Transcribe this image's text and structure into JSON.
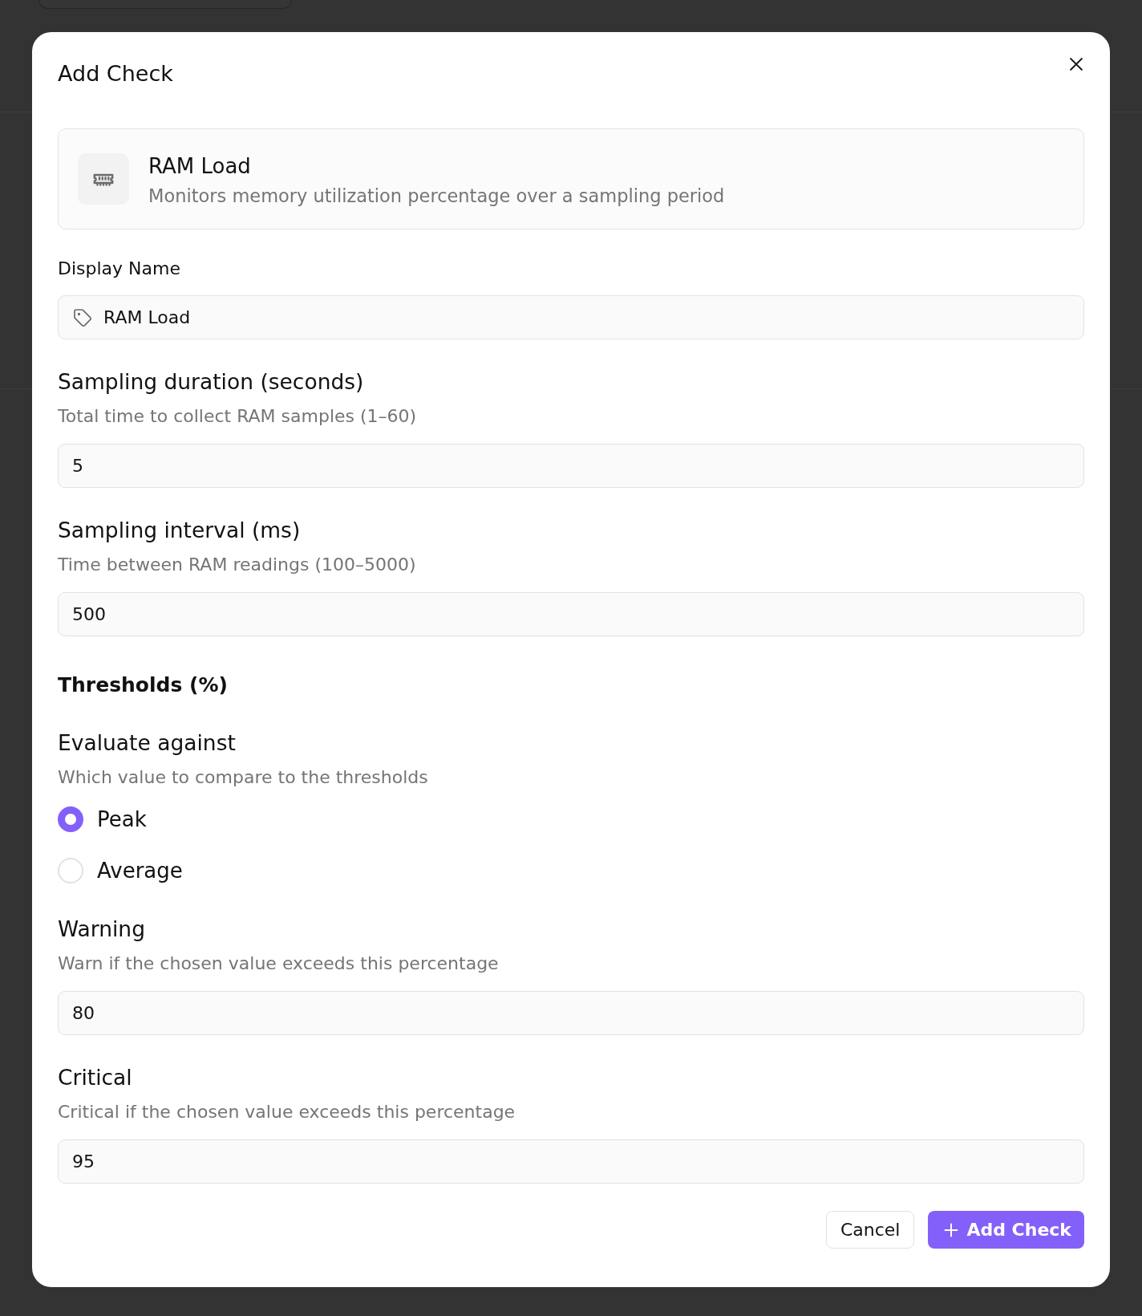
{
  "dialog": {
    "title": "Add Check"
  },
  "check_type": {
    "name": "RAM Load",
    "description": "Monitors memory utilization percentage over a sampling period"
  },
  "display_name": {
    "label": "Display Name",
    "value": "RAM Load"
  },
  "sampling": [
    {
      "label": "Sampling duration (seconds)",
      "hint": "Total time to collect RAM samples (1–60)",
      "value": "5"
    },
    {
      "label": "Sampling interval (ms)",
      "hint": "Time between RAM readings (100–5000)",
      "value": "500"
    }
  ],
  "thresholds": {
    "heading": "Thresholds (%)",
    "evaluate": {
      "label": "Evaluate against",
      "hint": "Which value to compare to the thresholds",
      "options": [
        {
          "label": "Peak",
          "selected": true
        },
        {
          "label": "Average",
          "selected": false
        }
      ]
    },
    "levels": [
      {
        "label": "Warning",
        "hint": "Warn if the chosen value exceeds this percentage",
        "value": "80"
      },
      {
        "label": "Critical",
        "hint": "Critical if the chosen value exceeds this percentage",
        "value": "95"
      }
    ]
  },
  "buttons": [
    {
      "label": "Cancel",
      "kind": "secondary"
    },
    {
      "label": "Add Check",
      "kind": "primary"
    }
  ]
}
